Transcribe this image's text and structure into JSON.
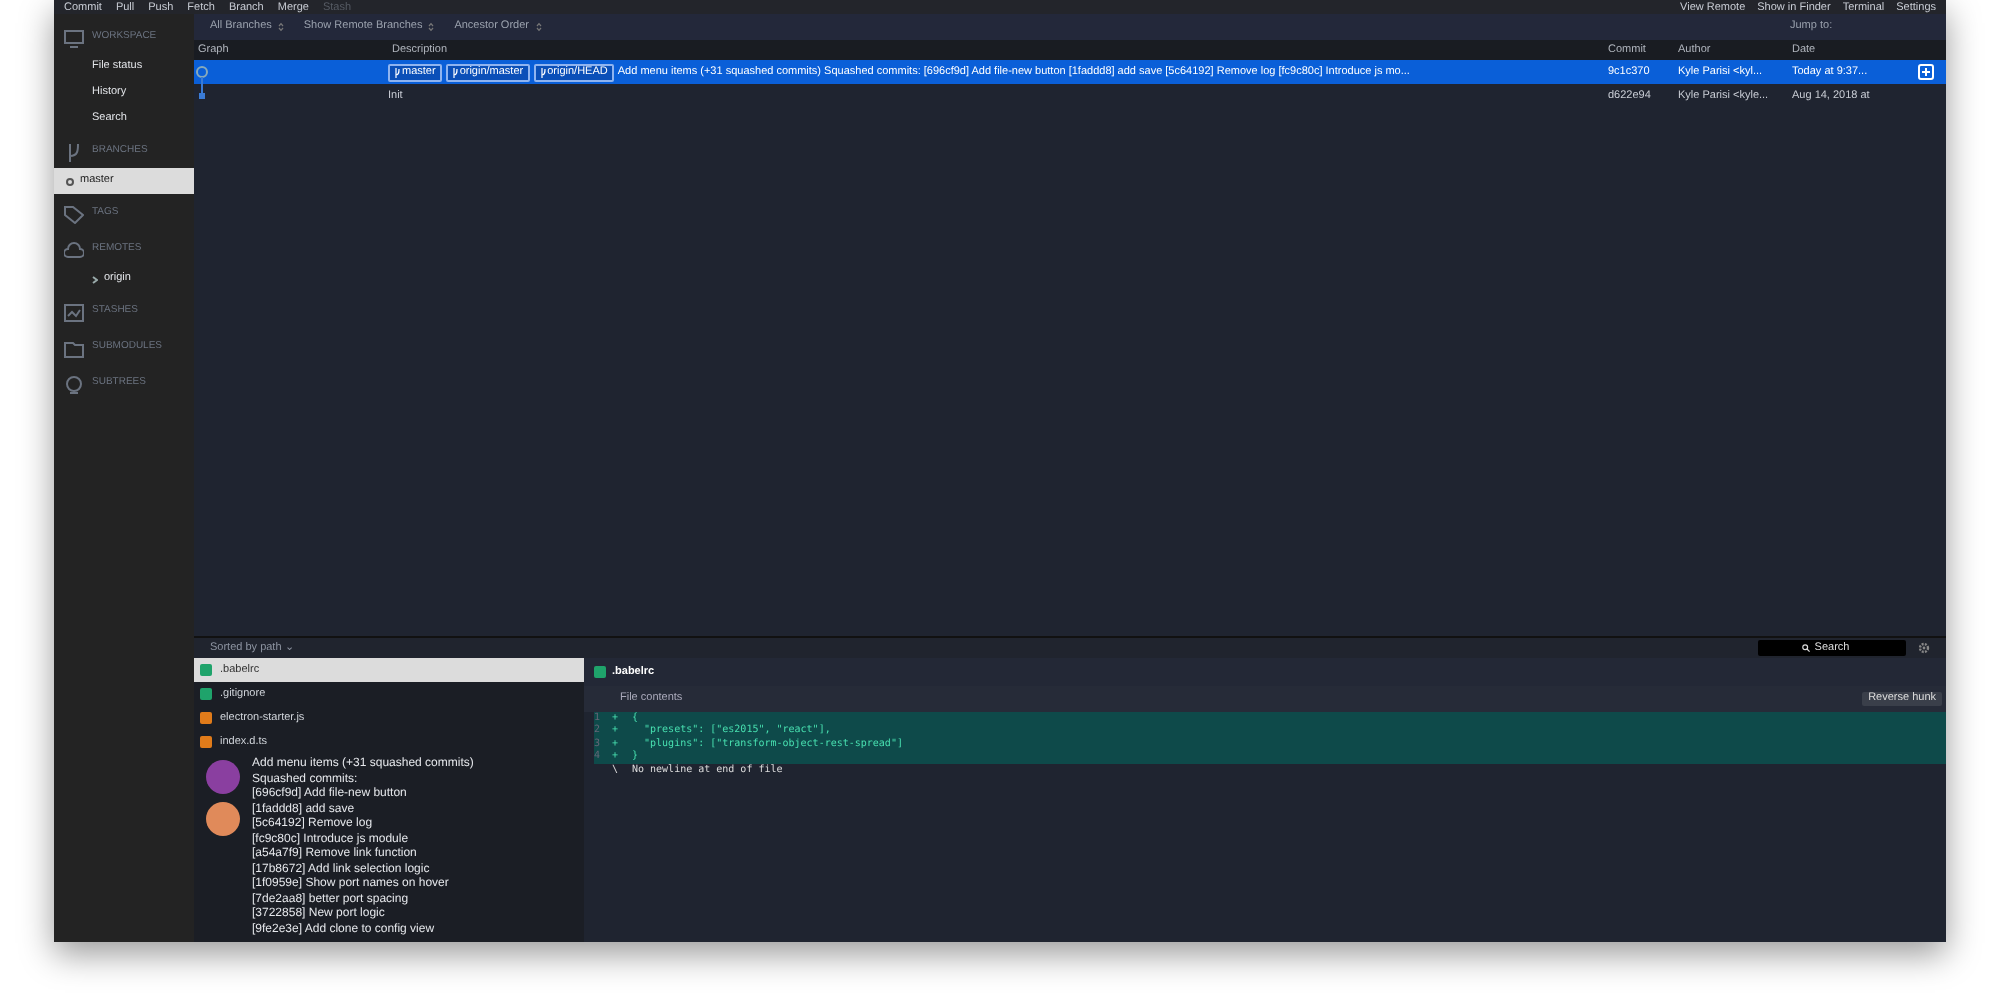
{
  "toolbar": {
    "left": [
      {
        "label": "Commit",
        "disabled": false
      },
      {
        "label": "Pull",
        "disabled": false
      },
      {
        "label": "Push",
        "disabled": false
      },
      {
        "label": "Fetch",
        "disabled": false
      },
      {
        "label": "Branch",
        "disabled": false
      },
      {
        "label": "Merge",
        "disabled": false
      },
      {
        "label": "Stash",
        "disabled": true
      }
    ],
    "right": [
      "View Remote",
      "Show in Finder",
      "Terminal",
      "Settings"
    ]
  },
  "sidebar": [
    {
      "kind": "workspace",
      "title": "WORKSPACE",
      "items": [
        {
          "label": "File status",
          "selected": false
        },
        {
          "label": "History",
          "selected": false
        },
        {
          "label": "Search",
          "selected": false
        }
      ]
    },
    {
      "kind": "branches",
      "title": "BRANCHES",
      "items": [
        {
          "label": "master",
          "selected": true
        }
      ]
    },
    {
      "kind": "tags",
      "title": "TAGS"
    },
    {
      "kind": "remotes",
      "title": "REMOTES",
      "items": [
        {
          "label": "origin",
          "selected": false,
          "expanded": false
        }
      ]
    },
    {
      "kind": "stashes",
      "title": "STASHES"
    },
    {
      "kind": "submodules",
      "title": "SUBMODULES"
    },
    {
      "kind": "subtrees",
      "title": "SUBTREES"
    }
  ],
  "filters": [
    "All Branches",
    "Show Remote Branches",
    "Ancestor Order"
  ],
  "jump_to": "Jump to:",
  "table": {
    "columns": [
      "Graph",
      "Description",
      "Commit",
      "Author",
      "Date"
    ],
    "rows": [
      {
        "selected": true,
        "refs": [
          "master",
          "origin/master",
          "origin/HEAD"
        ],
        "description": "Add menu items (+31 squashed commits) Squashed commits: [696cf9d] Add file-new button [1faddd8] add save [5c64192] Remove log [fc9c80c] Introduce js mo...",
        "commit": "9c1c370",
        "author": "Kyle Parisi <kyl...",
        "date": "Today at 9:37..."
      },
      {
        "selected": false,
        "refs": [],
        "description": "Init",
        "commit": "d622e94",
        "author": "Kyle Parisi <kyle...",
        "date": "Aug 14, 2018 at"
      }
    ]
  },
  "files_toolbar": {
    "sort": "Sorted by path ⌄",
    "search": {
      "placeholder": "Search"
    }
  },
  "files": [
    {
      "name": ".babelrc",
      "kind": "added",
      "selected": true
    },
    {
      "name": ".gitignore",
      "kind": "added",
      "selected": false
    },
    {
      "name": "electron-starter.js",
      "kind": "modified",
      "selected": false
    },
    {
      "name": "index.d.ts",
      "kind": "modified",
      "selected": false
    }
  ],
  "commit_message": [
    "Add menu items (+31 squashed commits)",
    "Squashed commits:",
    "[696cf9d] Add file-new button",
    "[1faddd8] add save",
    "[5c64192] Remove log",
    "[fc9c80c] Introduce js module",
    "[a54a7f9] Remove link function",
    "[17b8672] Add link selection logic",
    "[1f0959e] Show port names on hover",
    "[7de2aa8] better port spacing",
    "[3722858] New port logic",
    "[9fe2e3e] Add clone to config view"
  ],
  "diff": {
    "file": ".babelrc",
    "hunk_title": "File contents",
    "hunk_button": "Reverse hunk",
    "lines": [
      {
        "number": "1",
        "kind": "added",
        "sign": "+",
        "text": "{"
      },
      {
        "number": "2",
        "kind": "added",
        "sign": "+",
        "text": "  \"presets\": [\"es2015\", \"react\"],"
      },
      {
        "number": "3",
        "kind": "added",
        "sign": "+",
        "text": "  \"plugins\": [\"transform-object-rest-spread\"]"
      },
      {
        "number": "4",
        "kind": "added",
        "sign": "+",
        "text": "}"
      },
      {
        "kind": "note",
        "sign": "\\",
        "text": "No newline at end of file"
      }
    ]
  }
}
